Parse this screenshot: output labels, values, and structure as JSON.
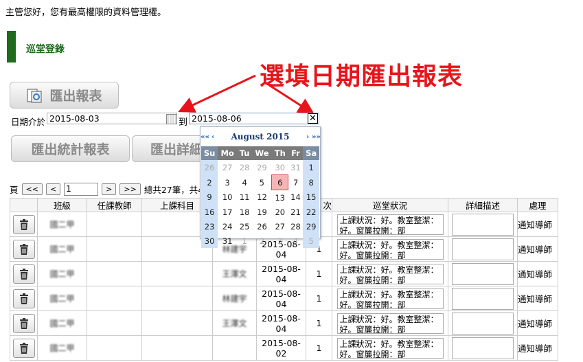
{
  "greeting": "主管您好，您有最高權限的資料管理權。",
  "section_title": "巡堂登錄",
  "annotation": "選填日期匯出報表",
  "buttons": {
    "export_report": "匯出報表",
    "export_stats": "匯出統計報表",
    "export_detail": "匯出詳細"
  },
  "date_filter": {
    "label": "日期介於",
    "from": "2015-08-03",
    "to_label": "到",
    "to": "2015-08-06"
  },
  "calendar": {
    "month": "August 2015",
    "nav": [
      "««",
      "‹",
      "›",
      "»»"
    ],
    "weekdays": [
      "Su",
      "Mo",
      "Tu",
      "We",
      "Th",
      "Fr",
      "Sa"
    ],
    "weeks": [
      [
        "26",
        "27",
        "28",
        "29",
        "30",
        "31",
        "1"
      ],
      [
        "2",
        "3",
        "4",
        "5",
        "6",
        "7",
        "8"
      ],
      [
        "9",
        "10",
        "11",
        "12",
        "13",
        "14",
        "15"
      ],
      [
        "16",
        "17",
        "18",
        "19",
        "20",
        "21",
        "22"
      ],
      [
        "23",
        "24",
        "25",
        "26",
        "27",
        "28",
        "29"
      ],
      [
        "30",
        "31",
        "1",
        "2",
        "3",
        "4",
        "5"
      ]
    ],
    "today": "6"
  },
  "pager": {
    "prefix": "頁",
    "first": "<<",
    "prev": "<",
    "page": "1",
    "next": ">",
    "last": ">>",
    "summary": "總共27筆，共4"
  },
  "table": {
    "headers": [
      "",
      "班級",
      "任課教師",
      "上課科目",
      "",
      "",
      "次",
      "巡堂狀況",
      "詳細描述",
      "處理"
    ],
    "rows": [
      {
        "class": "國二甲",
        "teacher": "",
        "subject": "",
        "staff": "",
        "date": "",
        "count": "",
        "status": "上課狀況：好。教室整潔：好。窗簾拉開：部",
        "action": "通知導師"
      },
      {
        "class": "國二甲",
        "teacher": "",
        "subject": "",
        "staff": "林建宇",
        "date": "2015-08-04",
        "count": "1",
        "status": "上課狀況：好。教室整潔：好。窗簾拉開：部",
        "action": "通知導師"
      },
      {
        "class": "國二甲",
        "teacher": "",
        "subject": "",
        "staff": "王澤文",
        "date": "2015-08-04",
        "count": "1",
        "status": "上課狀況：好。教室整潔：好。窗簾拉開：部",
        "action": "通知導師"
      },
      {
        "class": "國二甲",
        "teacher": "",
        "subject": "",
        "staff": "林建宇",
        "date": "2015-08-04",
        "count": "1",
        "status": "上課狀況：好。教室整潔：好。窗簾拉開：部",
        "action": "通知導師"
      },
      {
        "class": "國二甲",
        "teacher": "",
        "subject": "",
        "staff": "王澤文",
        "date": "2015-08-04",
        "count": "1",
        "status": "上課狀況：好。教室整潔：好。窗簾拉開：部",
        "action": "通知導師"
      },
      {
        "class": "國二甲",
        "teacher": "",
        "subject": "",
        "staff": "",
        "date": "2015-08-02",
        "count": "1",
        "status": "上課狀況：好。教室整潔：好。窗簾拉開：部",
        "action": "通知導師"
      }
    ]
  },
  "colors": {
    "annotation": "#e8141b",
    "section": "#1e6b1e",
    "weekend": "#cfe1f6",
    "today": "#f6b4b4"
  }
}
